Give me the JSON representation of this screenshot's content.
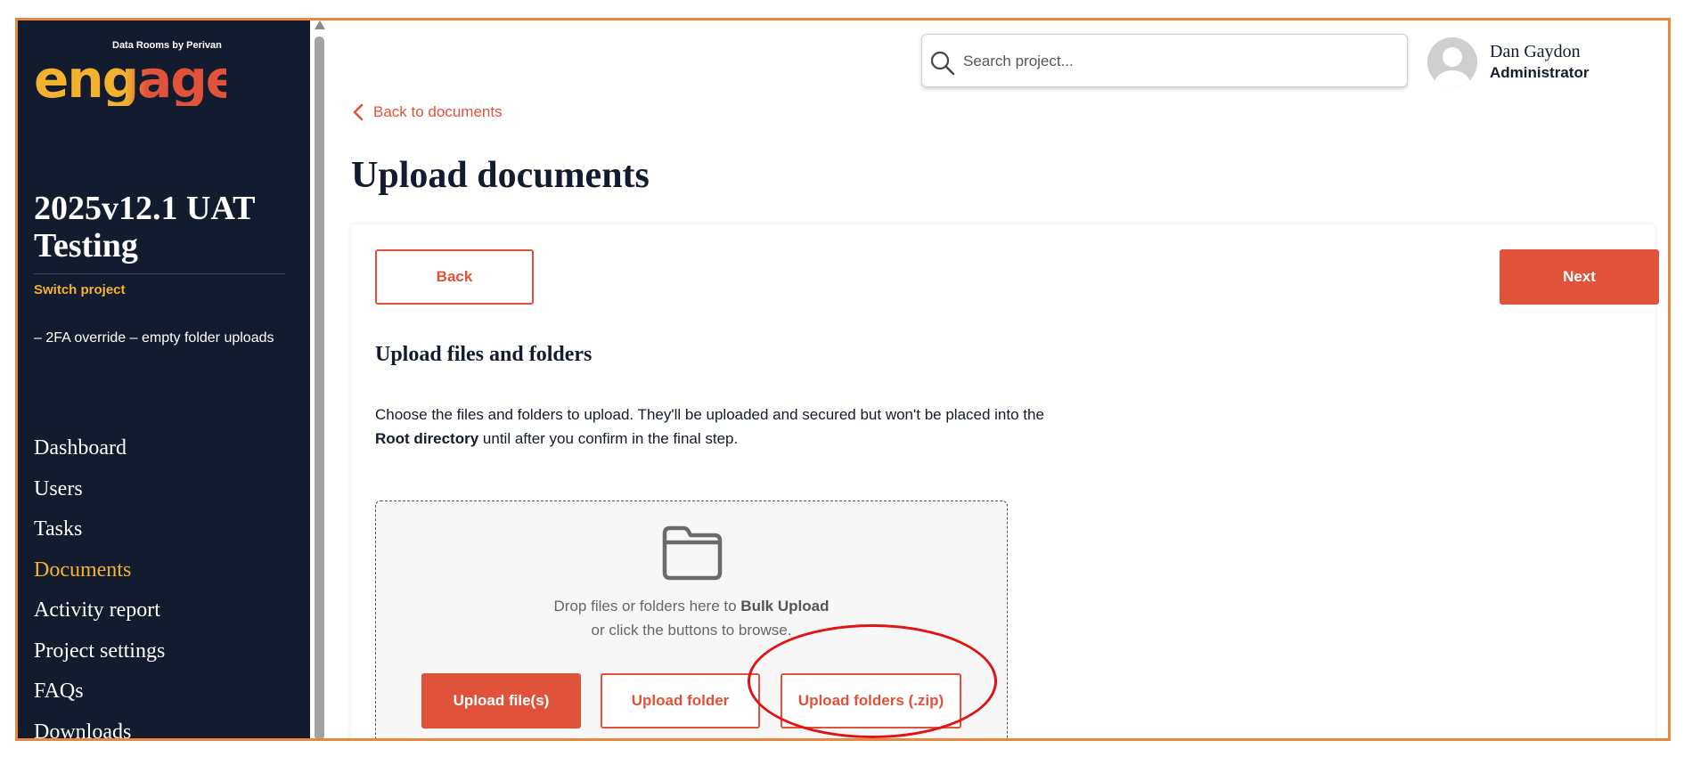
{
  "brand": {
    "subtitle": "Data Rooms by Perivan",
    "logo_text": "engage",
    "logo_colors": [
      "#f2b22e",
      "#e0533a"
    ]
  },
  "sidebar": {
    "project_title": "2025v12.1 UAT Testing",
    "switch_project_label": "Switch project",
    "project_description": "– 2FA override – empty folder uploads",
    "nav_items": [
      {
        "label": "Dashboard",
        "active": false
      },
      {
        "label": "Users",
        "active": false
      },
      {
        "label": "Tasks",
        "active": false
      },
      {
        "label": "Documents",
        "active": true
      },
      {
        "label": "Activity report",
        "active": false
      },
      {
        "label": "Project settings",
        "active": false
      },
      {
        "label": "FAQs",
        "active": false
      },
      {
        "label": "Downloads",
        "active": false
      }
    ]
  },
  "header": {
    "search_placeholder": "Search project...",
    "user_name": "Dan Gaydon",
    "user_role": "Administrator"
  },
  "main": {
    "back_link_label": "Back to documents",
    "page_title": "Upload documents",
    "back_button_label": "Back",
    "next_button_label": "Next",
    "section_title": "Upload files and folders",
    "intro_before": "Choose the files and folders to upload. They'll be uploaded and secured but won't be placed into the ",
    "intro_strong": "Root directory",
    "intro_after": " until after you confirm in the final step.",
    "dropzone": {
      "line1_before": "Drop files or folders here to ",
      "line1_strong": "Bulk Upload",
      "line2": "or click the buttons to browse.",
      "upload_files_label": "Upload file(s)",
      "upload_folder_label": "Upload folder",
      "upload_zip_label": "Upload folders (.zip)"
    }
  },
  "colors": {
    "sidebar_bg": "#131b2e",
    "accent": "#e0533a",
    "active_nav": "#f2b22e",
    "frame_border": "#e8873f",
    "annotation": "#e01414"
  }
}
